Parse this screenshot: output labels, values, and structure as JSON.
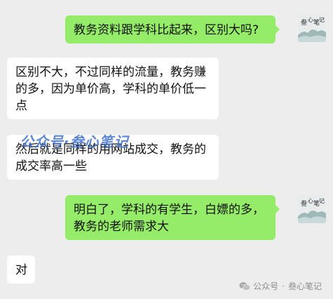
{
  "messages": [
    {
      "side": "out",
      "text": "教务资料跟学科比起来，区别大吗?"
    },
    {
      "side": "in",
      "text": "区别不大，不过同样的流量，教务赚的多，因为单价高，学科的单价低一点"
    },
    {
      "side": "in",
      "text": "然后就是同样的用网站成交，教务的成交率高一些"
    },
    {
      "side": "out",
      "text": "明白了，学科的有学生，白嫖的多，教务的老师需求大"
    },
    {
      "side": "in",
      "text": "对"
    }
  ],
  "watermark": "公众号·叁心笔记",
  "avatar": {
    "seal_text": "叁心笔记",
    "colors": {
      "ink": "#2a2a2a",
      "mountain": "#9fb8b8",
      "bg": "#e8ecec"
    }
  },
  "footer": {
    "icon": "wechat-icon",
    "platform": "公众号",
    "separator": "·",
    "account": "叁心笔记"
  },
  "colors": {
    "background": "#ededed",
    "outgoing_bubble": "#95ec69",
    "incoming_bubble": "#ffffff",
    "text": "#111111",
    "footer_text": "#8c8c8c"
  }
}
